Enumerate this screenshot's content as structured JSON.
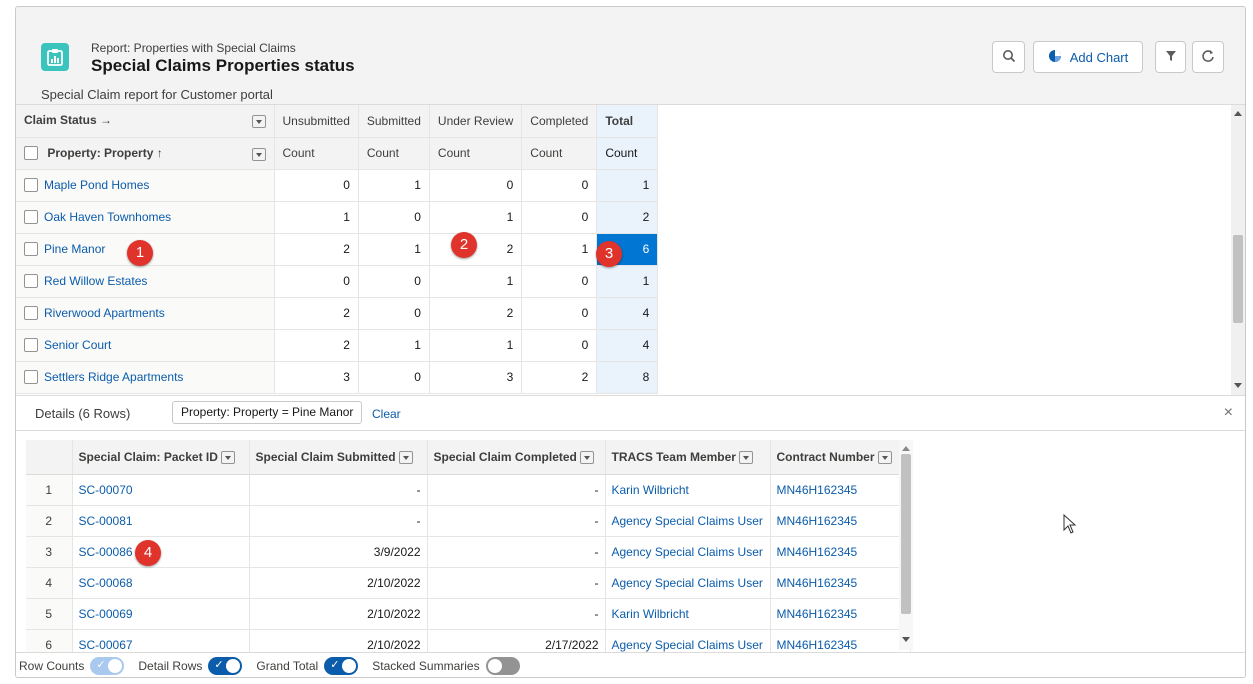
{
  "header": {
    "report_type": "Report: Properties with Special Claims",
    "title": "Special Claims Properties status",
    "description": "Special Claim report for Customer portal",
    "add_chart_label": "Add Chart"
  },
  "summary": {
    "claim_status_label": "Claim Status →",
    "property_label": "Property: Property ↑",
    "columns": [
      "Unsubmitted",
      "Submitted",
      "Under Review",
      "Completed",
      "Total"
    ],
    "count_label": "Count",
    "rows": [
      {
        "name": "Maple Pond Homes",
        "values": [
          "0",
          "1",
          "0",
          "0",
          "1"
        ]
      },
      {
        "name": "Oak Haven Townhomes",
        "values": [
          "1",
          "0",
          "1",
          "0",
          "2"
        ]
      },
      {
        "name": "Pine Manor",
        "values": [
          "2",
          "1",
          "2",
          "1",
          "6"
        ]
      },
      {
        "name": "Red Willow Estates",
        "values": [
          "0",
          "0",
          "1",
          "0",
          "1"
        ]
      },
      {
        "name": "Riverwood Apartments",
        "values": [
          "2",
          "0",
          "2",
          "0",
          "4"
        ]
      },
      {
        "name": "Senior Court",
        "values": [
          "2",
          "1",
          "1",
          "0",
          "4"
        ]
      },
      {
        "name": "Settlers Ridge Apartments",
        "values": [
          "3",
          "0",
          "3",
          "2",
          "8"
        ]
      }
    ]
  },
  "details": {
    "title": "Details (6 Rows)",
    "filter": "Property: Property = Pine Manor",
    "clear": "Clear",
    "close": "×",
    "columns": [
      "Special Claim: Packet ID",
      "Special Claim Submitted",
      "Special Claim Completed",
      "TRACS Team Member",
      "Contract Number"
    ],
    "rows": [
      {
        "n": "1",
        "id": "SC-00070",
        "submitted": "-",
        "completed": "-",
        "member": "Karin Wilbricht",
        "contract": "MN46H162345"
      },
      {
        "n": "2",
        "id": "SC-00081",
        "submitted": "-",
        "completed": "-",
        "member": "Agency Special Claims User",
        "contract": "MN46H162345"
      },
      {
        "n": "3",
        "id": "SC-00086",
        "submitted": "3/9/2022",
        "completed": "-",
        "member": "Agency Special Claims User",
        "contract": "MN46H162345"
      },
      {
        "n": "4",
        "id": "SC-00068",
        "submitted": "2/10/2022",
        "completed": "-",
        "member": "Agency Special Claims User",
        "contract": "MN46H162345"
      },
      {
        "n": "5",
        "id": "SC-00069",
        "submitted": "2/10/2022",
        "completed": "-",
        "member": "Karin Wilbricht",
        "contract": "MN46H162345"
      },
      {
        "n": "6",
        "id": "SC-00067",
        "submitted": "2/10/2022",
        "completed": "2/17/2022",
        "member": "Agency Special Claims User",
        "contract": "MN46H162345"
      }
    ]
  },
  "footer": {
    "row_counts": "Row Counts",
    "detail_rows": "Detail Rows",
    "grand_total": "Grand Total",
    "stacked_summaries": "Stacked Summaries"
  },
  "callouts": [
    "1",
    "2",
    "3",
    "4"
  ],
  "colors": {
    "accent": "#0b5cab",
    "selected": "#0176d3",
    "badge": "#e0332b",
    "icon": "#3bc4bd"
  }
}
